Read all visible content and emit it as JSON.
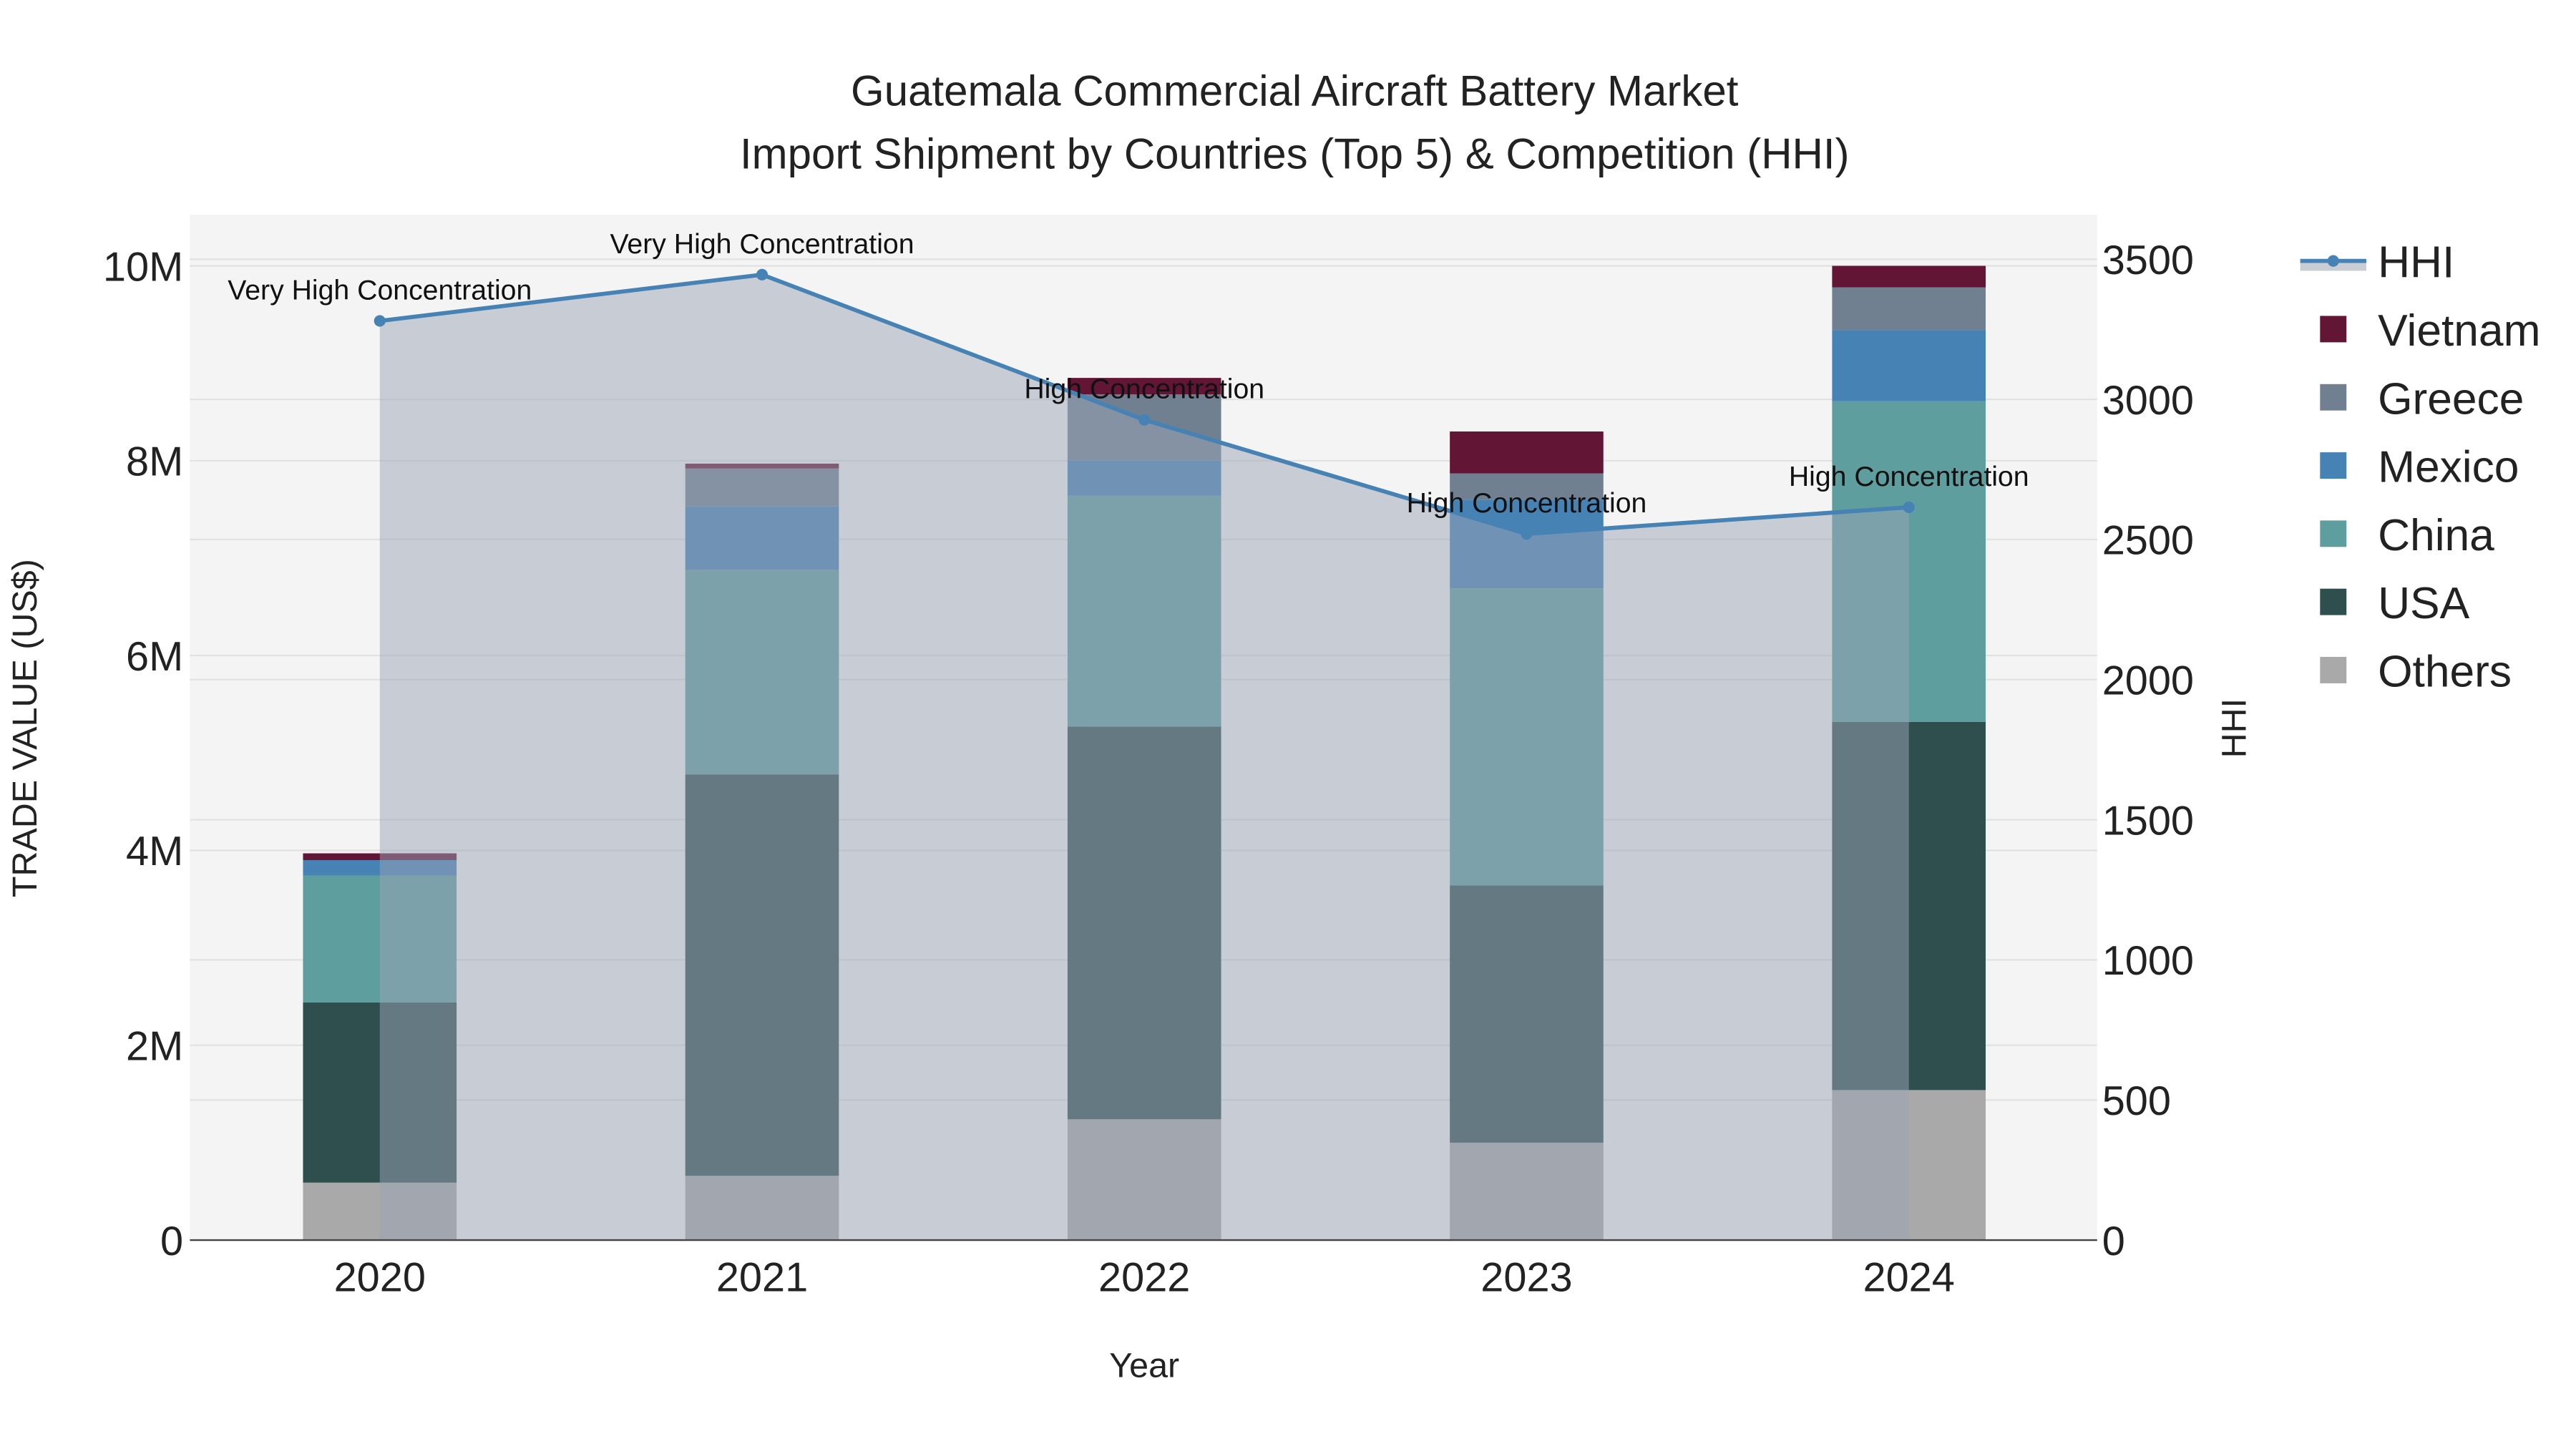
{
  "chart_data": {
    "type": "bar",
    "stacked": true,
    "title": "Guatemala Commercial Aircraft Battery Market",
    "subtitle": "Import Shipment by Countries (Top 5) & Competition (HHI)",
    "xlabel": "Year",
    "ylabel": "TRADE VALUE (US$)",
    "y2label": "HHI",
    "categories": [
      "2020",
      "2021",
      "2022",
      "2023",
      "2024"
    ],
    "ylim": [
      0,
      10500000
    ],
    "y2lim": [
      0,
      3650
    ],
    "yticks": [
      0,
      2000000,
      4000000,
      6000000,
      8000000,
      10000000
    ],
    "ytick_labels": [
      "0",
      "2M",
      "4M",
      "6M",
      "8M",
      "10M"
    ],
    "y2ticks": [
      0,
      500,
      1000,
      1500,
      2000,
      2500,
      3000,
      3500
    ],
    "y2tick_labels": [
      "0",
      "500",
      "1000",
      "1500",
      "2000",
      "2500",
      "3000",
      "3500"
    ],
    "grid": true,
    "legend_position": "right",
    "series": [
      {
        "name": "Others",
        "color": "#a9a9a9",
        "values": [
          590000,
          660000,
          1240000,
          1000000,
          1540000
        ]
      },
      {
        "name": "USA",
        "color": "#2f4f4f",
        "values": [
          1850000,
          4120000,
          4030000,
          2640000,
          3780000
        ]
      },
      {
        "name": "China",
        "color": "#5f9e9e",
        "values": [
          1300000,
          2100000,
          2370000,
          3050000,
          3290000
        ]
      },
      {
        "name": "Mexico",
        "color": "#4682b4",
        "values": [
          160000,
          650000,
          360000,
          910000,
          730000
        ]
      },
      {
        "name": "Greece",
        "color": "#708090",
        "values": [
          0,
          390000,
          680000,
          270000,
          440000
        ]
      },
      {
        "name": "Vietnam",
        "color": "#631535",
        "values": [
          70000,
          50000,
          170000,
          430000,
          220000
        ]
      }
    ],
    "line": {
      "name": "HHI",
      "color": "#4682b4",
      "values": [
        3280,
        3445,
        2927,
        2520,
        2615
      ],
      "annotations": [
        "Very High Concentration",
        "Very High Concentration",
        "High Concentration",
        "High Concentration",
        "High Concentration"
      ]
    },
    "legend": [
      "HHI",
      "Vietnam",
      "Greece",
      "Mexico",
      "China",
      "USA",
      "Others"
    ]
  }
}
